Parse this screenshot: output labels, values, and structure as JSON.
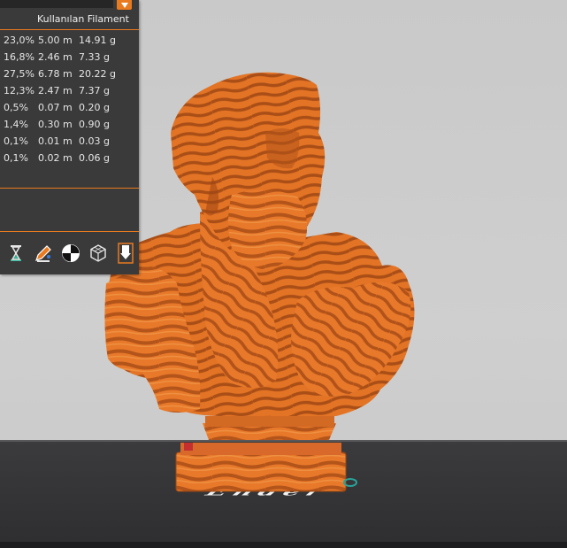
{
  "panel": {
    "column_header": "Kullanılan Filament",
    "rows": [
      {
        "percent": "23,0%",
        "length": "5.00 m",
        "weight": "14.91 g"
      },
      {
        "percent": "16,8%",
        "length": "2.46 m",
        "weight": "7.33 g"
      },
      {
        "percent": "27,5%",
        "length": "6.78 m",
        "weight": "20.22 g"
      },
      {
        "percent": "12,3%",
        "length": "2.47 m",
        "weight": "7.37 g"
      },
      {
        "percent": "0,5%",
        "length": "0.07 m",
        "weight": "0.20 g"
      },
      {
        "percent": "1,4%",
        "length": "0.30 m",
        "weight": "0.90 g"
      },
      {
        "percent": "0,1%",
        "length": "0.01 m",
        "weight": "0.03 g"
      },
      {
        "percent": "0,1%",
        "length": "0.02 m",
        "weight": "0.06 g"
      }
    ],
    "toolbar_icons": [
      "hourglass-icon",
      "pencil-edit-icon",
      "color-wheel-icon",
      "cube-wireframe-icon",
      "export-icon"
    ]
  },
  "viewport": {
    "bed_logo": "Ender"
  },
  "colors": {
    "accent": "#e87a1f",
    "model_orange": "#e8792a",
    "model_dark": "#b3541a",
    "panel_bg": "#3a3a3b"
  }
}
